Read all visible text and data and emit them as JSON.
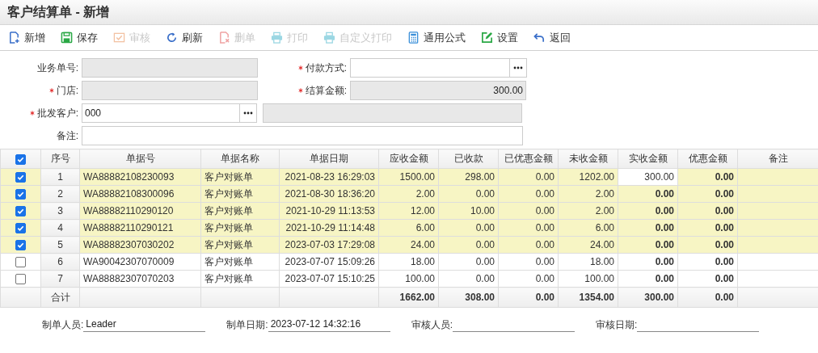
{
  "window": {
    "title": "客户结算单 - 新增"
  },
  "toolbar": [
    {
      "label": "新增",
      "kind": "new",
      "disabled": false
    },
    {
      "label": "保存",
      "kind": "save",
      "disabled": false
    },
    {
      "label": "审核",
      "kind": "approve",
      "disabled": true
    },
    {
      "label": "刷新",
      "kind": "refresh",
      "disabled": false
    },
    {
      "label": "删单",
      "kind": "delete",
      "disabled": true
    },
    {
      "label": "打印",
      "kind": "print",
      "disabled": true
    },
    {
      "label": "自定义打印",
      "kind": "print",
      "disabled": true
    },
    {
      "label": "通用公式",
      "kind": "formula",
      "disabled": false
    },
    {
      "label": "设置",
      "kind": "settings",
      "disabled": false
    },
    {
      "label": "返回",
      "kind": "back",
      "disabled": false
    }
  ],
  "form": {
    "business_no": {
      "label": "业务单号:",
      "required": false
    },
    "payment_method": {
      "label": "付款方式:",
      "required": true
    },
    "store": {
      "label": "门店:",
      "required": true
    },
    "settle_amount": {
      "label": "结算金额:",
      "required": true,
      "value": "300.00"
    },
    "customer": {
      "label": "批发客户:",
      "required": true,
      "value": "000"
    },
    "note": {
      "label": "备注:",
      "required": false
    }
  },
  "table": {
    "all_checked": true,
    "columns": [
      "序号",
      "单据号",
      "单据名称",
      "单据日期",
      "应收金额",
      "已收款",
      "已优惠金额",
      "未收金额",
      "实收金额",
      "优惠金额",
      "备注"
    ],
    "rows": [
      {
        "checked": true,
        "editing": true,
        "cells": [
          "1",
          "WA88882108230093",
          "客户对账单",
          "2021-08-23 16:29:03",
          "1500.00",
          "298.00",
          "0.00",
          "1202.00",
          "300.00",
          "0.00"
        ]
      },
      {
        "checked": true,
        "editing": false,
        "cells": [
          "2",
          "WA88882108300096",
          "客户对账单",
          "2021-08-30 18:36:20",
          "2.00",
          "0.00",
          "0.00",
          "2.00",
          "0.00",
          "0.00"
        ]
      },
      {
        "checked": true,
        "editing": false,
        "cells": [
          "3",
          "WA88882110290120",
          "客户对账单",
          "2021-10-29 11:13:53",
          "12.00",
          "10.00",
          "0.00",
          "2.00",
          "0.00",
          "0.00"
        ]
      },
      {
        "checked": true,
        "editing": false,
        "cells": [
          "4",
          "WA88882110290121",
          "客户对账单",
          "2021-10-29 11:14:48",
          "6.00",
          "0.00",
          "0.00",
          "6.00",
          "0.00",
          "0.00"
        ]
      },
      {
        "checked": true,
        "editing": false,
        "cells": [
          "5",
          "WA88882307030202",
          "客户对账单",
          "2023-07-03 17:29:08",
          "24.00",
          "0.00",
          "0.00",
          "24.00",
          "0.00",
          "0.00"
        ]
      },
      {
        "checked": false,
        "editing": false,
        "cells": [
          "6",
          "WA90042307070009",
          "客户对账单",
          "2023-07-07 15:09:26",
          "18.00",
          "0.00",
          "0.00",
          "18.00",
          "0.00",
          "0.00"
        ]
      },
      {
        "checked": false,
        "editing": false,
        "cells": [
          "7",
          "WA88882307070203",
          "客户对账单",
          "2023-07-07 15:10:25",
          "100.00",
          "0.00",
          "0.00",
          "100.00",
          "0.00",
          "0.00"
        ]
      }
    ],
    "totals": {
      "label": "合计",
      "amounts": [
        "1662.00",
        "308.00",
        "0.00",
        "1354.00",
        "300.00",
        "0.00"
      ]
    }
  },
  "footer": [
    {
      "label": "制单人员:",
      "value": "Leader"
    },
    {
      "label": "制单日期:",
      "value": "2023-07-12 14:32:16"
    },
    {
      "label": "审核人员:"
    },
    {
      "label": "审核日期:"
    }
  ]
}
